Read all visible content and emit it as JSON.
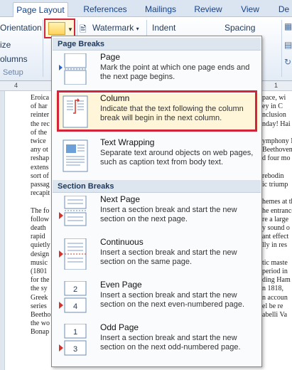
{
  "tabs": [
    "Page Layout",
    "References",
    "Mailings",
    "Review",
    "View",
    "De"
  ],
  "ribbon": {
    "orientation": "Orientation",
    "size": "ize",
    "columns": "olumns",
    "setup_group": "Setup",
    "watermark": "Watermark",
    "indent": "Indent",
    "spacing": "Spacing"
  },
  "ruler": [
    "4",
    "1"
  ],
  "menu": {
    "page_breaks_header": "Page Breaks",
    "section_breaks_header": "Section Breaks",
    "items": [
      {
        "title": "Page",
        "desc": "Mark the point at which one page ends and the next page begins."
      },
      {
        "title": "Column",
        "desc": "Indicate that the text following the column break will begin in the next column."
      },
      {
        "title": "Text Wrapping",
        "desc": "Separate text around objects on web pages, such as caption text from body text."
      },
      {
        "title": "Next Page",
        "desc": "Insert a section break and start the new section on the next page."
      },
      {
        "title": "Continuous",
        "desc": "Insert a section break and start the new section on the same page."
      },
      {
        "title": "Even Page",
        "desc": "Insert a section break and start the new section on the next even-numbered page."
      },
      {
        "title": "Odd Page",
        "desc": "Insert a section break and start the new section on the next odd-numbered page."
      }
    ],
    "icon_labels": {
      "even_top": "2",
      "even_bottom": "4",
      "odd_top": "1",
      "odd_bottom": "3"
    }
  },
  "doc": {
    "left": [
      "Eroica",
      "of har",
      "reinter",
      "the rec",
      "of the",
      "twice",
      "any ot",
      "reshap",
      "extens",
      "sort of",
      "passag",
      "recapit",
      "",
      "The fo",
      "follow",
      "death",
      "rapid",
      "quietly",
      "design",
      "music",
      "(1801",
      "for the",
      "the sy",
      "Greek",
      "series",
      "Beetho",
      "the wo",
      "Bonap"
    ],
    "right": [
      "pace, wi",
      "ey in C",
      "nclusion",
      "nday! Hai",
      "",
      "ymphony N",
      "Beethoven's",
      "d four mo",
      "",
      "rebodin",
      "ic triump",
      "",
      "hemes at th",
      "he entrance",
      "re a large",
      "y sound o",
      "ant effect",
      "lly in res",
      "",
      "tic maste",
      "period in",
      "ding Ham",
      "n 1818,",
      "n accoun",
      "el be re",
      "abelli Va"
    ]
  }
}
